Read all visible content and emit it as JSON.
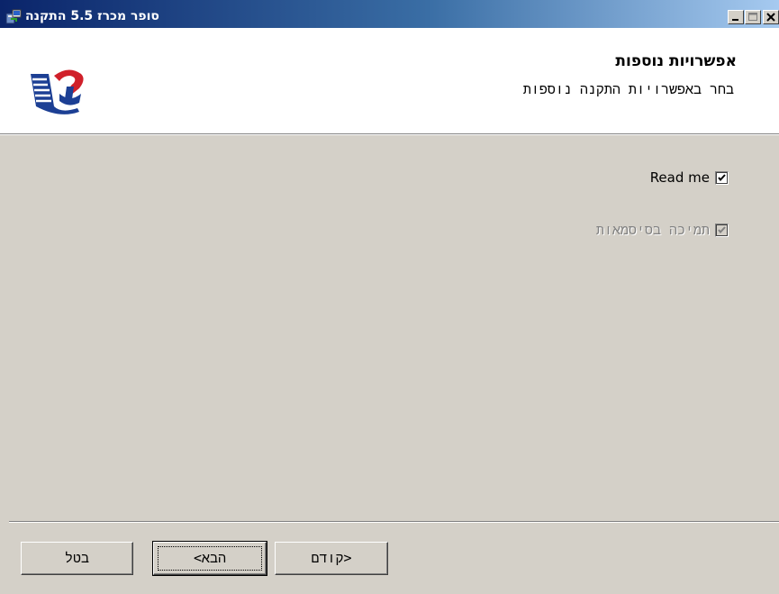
{
  "window": {
    "title": "סופר מכרז 5.5 התקנה",
    "controls": {
      "minimize_icon": "minimize-icon",
      "maximize_icon": "maximize-icon",
      "close_icon": "close-icon"
    }
  },
  "header": {
    "title": "אפשרויות נוספות",
    "subtitle": "בחר באפשרויות התקנה נוספות",
    "logo_icon": "app-logo-icon"
  },
  "options": [
    {
      "label": "Read me",
      "checked": true,
      "enabled": true
    },
    {
      "label": "תמיכה בסיסמאות",
      "checked": true,
      "enabled": false
    }
  ],
  "buttons": {
    "cancel": "בטל",
    "next": "הבא>",
    "back": "<קודם"
  },
  "colors": {
    "titlebar_start": "#0a246a",
    "titlebar_end": "#a6caf0",
    "face": "#d4d0c8",
    "logo_blue": "#1c3f94",
    "logo_red": "#d0202a"
  }
}
